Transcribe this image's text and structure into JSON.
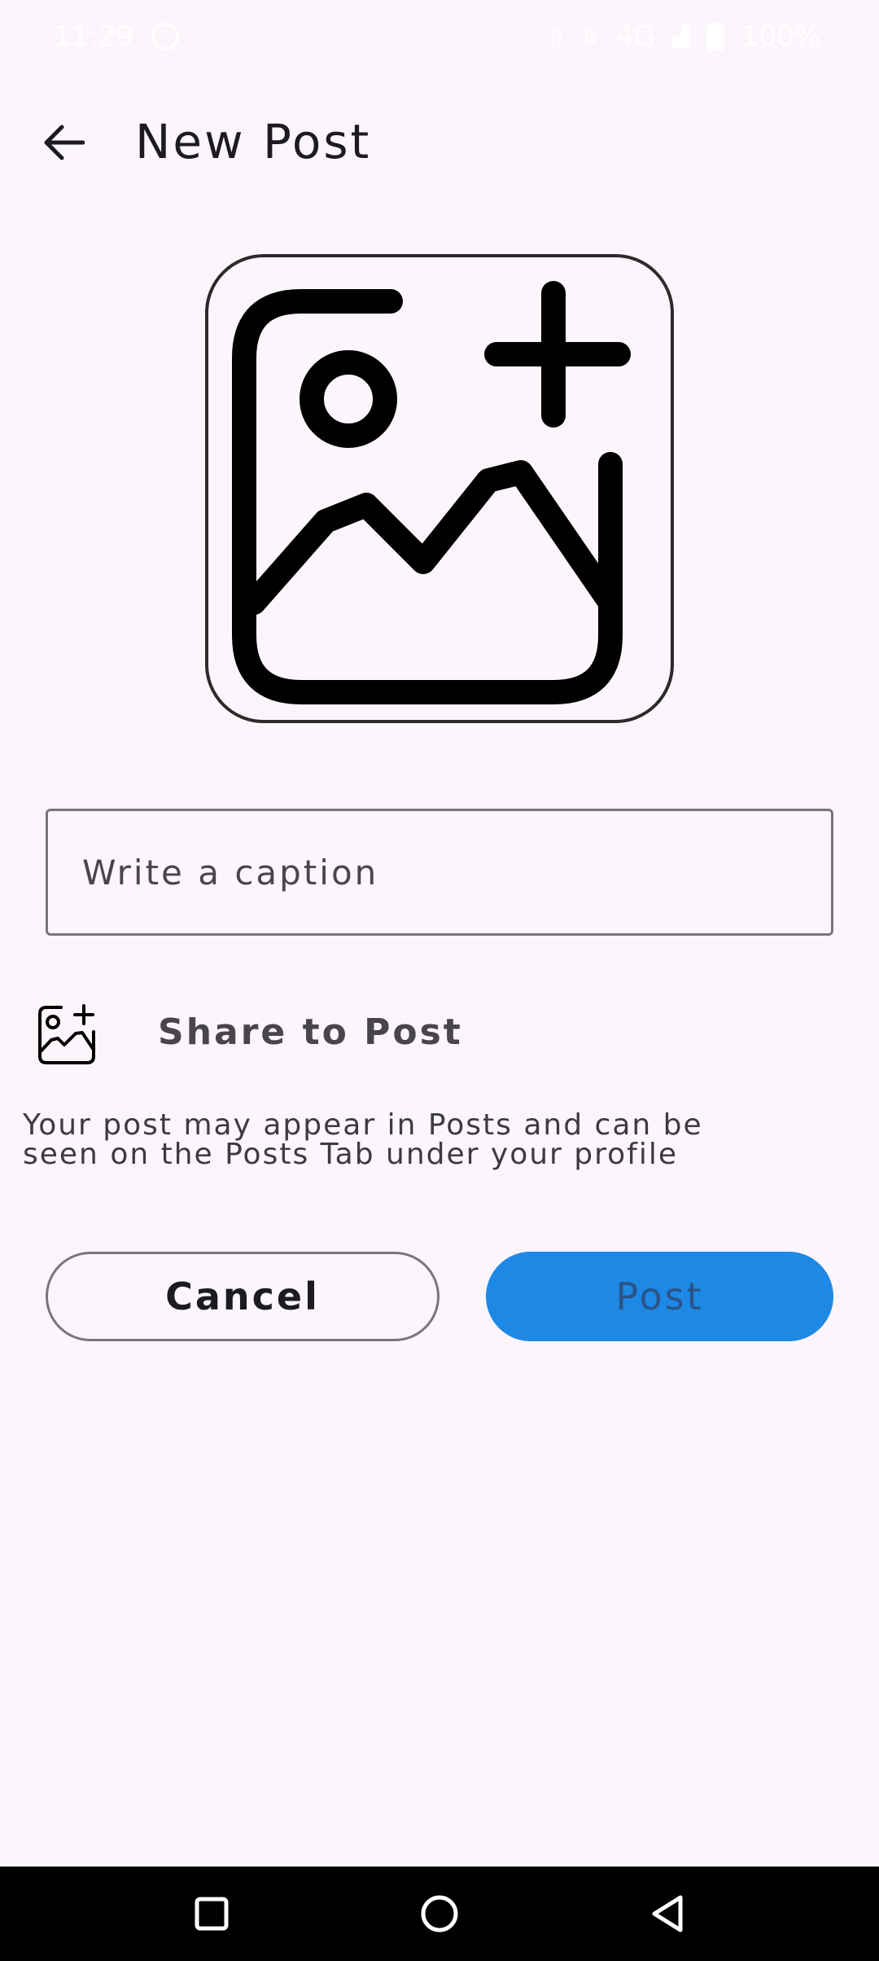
{
  "status_bar": {
    "time": "11:29",
    "network": "4G",
    "battery": "100%"
  },
  "app_bar": {
    "title": "New Post",
    "back_icon": "arrow-back-icon"
  },
  "image_picker": {
    "icon": "add-photo-icon"
  },
  "caption": {
    "placeholder": "Write a caption",
    "value": ""
  },
  "share": {
    "icon": "add-photo-icon",
    "label": "Share to Post",
    "note_line1": "Your post may appear in Posts and can be",
    "note_line2": "seen on the Posts Tab under your profile"
  },
  "actions": {
    "cancel_label": "Cancel",
    "post_label": "Post"
  },
  "nav_bar": {
    "recents_icon": "recents-square-icon",
    "home_icon": "home-circle-icon",
    "back_icon": "back-triangle-icon"
  },
  "colors": {
    "background": "#fcf6fc",
    "primary": "#1e88e5",
    "outline": "#79747e"
  }
}
